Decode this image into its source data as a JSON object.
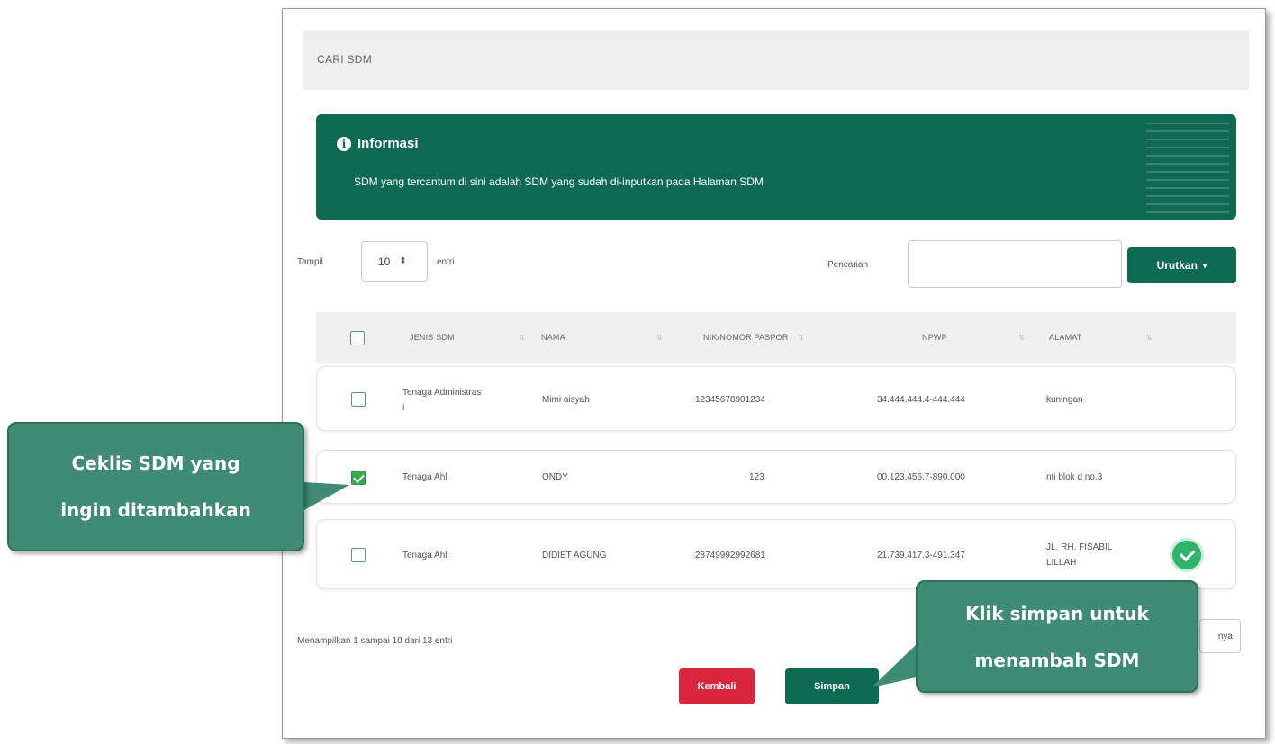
{
  "panel": {
    "title": "CARI SDM"
  },
  "info": {
    "icon": "info-circle-icon",
    "title": "Informasi",
    "text": "SDM yang tercantum di sini adalah SDM yang sudah di-inputkan pada Halaman SDM"
  },
  "controls": {
    "show_label": "Tampil",
    "show_value": "10",
    "show_suffix": "entri",
    "search_label": "Pencarian",
    "search_value": "",
    "sort_label": "Urutkan"
  },
  "table": {
    "headers": [
      "JENIS SDM",
      "NAMA",
      "NIK/NOMOR PASPOR",
      "NPWP",
      "ALAMAT"
    ],
    "rows": [
      {
        "jenis": "Tenaga Administrasi",
        "nama": "Mimi aisyah",
        "nik": "12345678901234",
        "npwp": "34.444.444.4-444.444",
        "alamat": "kuningan",
        "checked": false,
        "verified": false
      },
      {
        "jenis": "Tenaga Ahli",
        "nama": "ONDY",
        "nik": "123",
        "npwp": "00.123.456.7-890.000",
        "alamat": "nti blok d no.3",
        "checked": true,
        "verified": false
      },
      {
        "jenis": "Tenaga Ahli",
        "nama": "DIDIET AGUNG",
        "nik": "28749992992681",
        "npwp": "21.739.417.3-491.347",
        "alamat": "JL. RH. FISABIL LILLAH",
        "checked": false,
        "verified": true
      }
    ]
  },
  "pagination": {
    "summary": "Menampilkan 1 sampai 10 dari 13 entri",
    "next_label": "nya"
  },
  "actions": {
    "back_label": "Kembali",
    "save_label": "Simpan"
  },
  "callouts": {
    "check_line1": "Ceklis SDM yang",
    "check_line2": "ingin ditambahkan",
    "save_line1": "Klik simpan untuk",
    "save_line2": "menambah SDM"
  },
  "colors": {
    "primary": "#0f6a52",
    "danger": "#d9263d",
    "callout": "#3f8b74",
    "check": "#3aaa4c"
  }
}
